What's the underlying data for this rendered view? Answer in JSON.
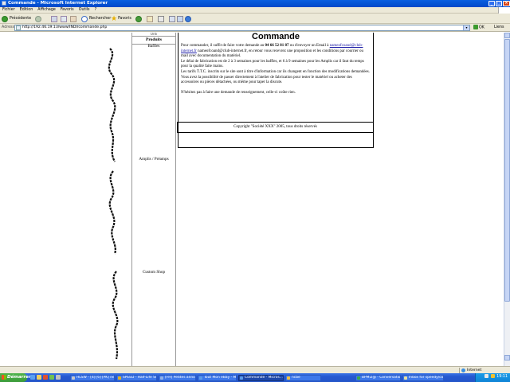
{
  "window": {
    "title": "Commande - Microsoft Internet Explorer",
    "buttons": {
      "minimize": "_",
      "maximize": "□",
      "close": "×"
    }
  },
  "menu": [
    "Fichier",
    "Edition",
    "Affichage",
    "Favoris",
    "Outils",
    "?"
  ],
  "toolbar": {
    "back_label": "Précédente",
    "search_label": "Rechercher",
    "favorites_label": "Favoris"
  },
  "address": {
    "label": "Adresse",
    "url": "http://192.46.19.13/www/INDI/commande.php",
    "go_label": "OK",
    "links_label": "Liens"
  },
  "nav": {
    "top_fragment": "Ordi",
    "header": "Produits",
    "items": [
      "Baffles",
      "Amplis / Préamps",
      "Custom Shop"
    ]
  },
  "main": {
    "title": "Commande",
    "p1_before": "Pour commander, il suffit de faire votre demande au ",
    "phone": "04 66 52 81 87",
    "p1_mid": " ou d'envoyer un Email à ",
    "email": "nameofcoand@club-internet.fr",
    "p1_after": " nameofcoand@club-internet.fr, en retour vous recevrez une proposition et les conditions par courrier ou mail avec documentation du matériel.",
    "p2": "Le délai de fabrication est de 2 à 3 semaines pour les baffles, et 6 à 9 semaines pour les Amplis car il faut du temps pour la qualité faite mains.",
    "p3": "Les tarifs T.T.C. inscrits sur le site sont à titre d'information car ils changent en fonction des modifications demandées.",
    "p4": "Vous avez la possibilité de passer directement à l'atelier de fabrication pour tester le matériel ou acheter des accessoires ou pièces détachées, ou même pour taper la discute.",
    "p5": "N'hésitez pas à faire une demande de renseignement, celle-ci coûte rien."
  },
  "footer": {
    "copyright": "Copyright \"Société XXX\" 2005, tous droits réservés"
  },
  "statusbar": {
    "zone": "Internet"
  },
  "taskbar": {
    "start": "Démarrer",
    "tasks": [
      {
        "label": "HLSW - [4]{6}[PK] ne...",
        "color": "#c8c8c8"
      },
      {
        "label": "SPEED - Half-Life Ser...",
        "color": "#e0b020"
      },
      {
        "label": "[FH] Petites annonces...",
        "color": "#8fb0e8"
      },
      {
        "label": "Tout Mon eBay - Micr...",
        "color": "#5a9ae8"
      },
      {
        "label": "Commande - Micros...",
        "color": "#5a9ae8"
      },
      {
        "label": "ncbe",
        "color": "#f0c040"
      },
      {
        "label": "BPMi2@ - Conversation",
        "color": "#3aa84a"
      },
      {
        "label": "Inbox for speedy/co...",
        "color": "#e8e0a0"
      }
    ],
    "clock": "19:11"
  },
  "colors": {
    "titlebar": "#0048c8",
    "link": "#1a1aa6",
    "taskbar": "#2456c9"
  }
}
